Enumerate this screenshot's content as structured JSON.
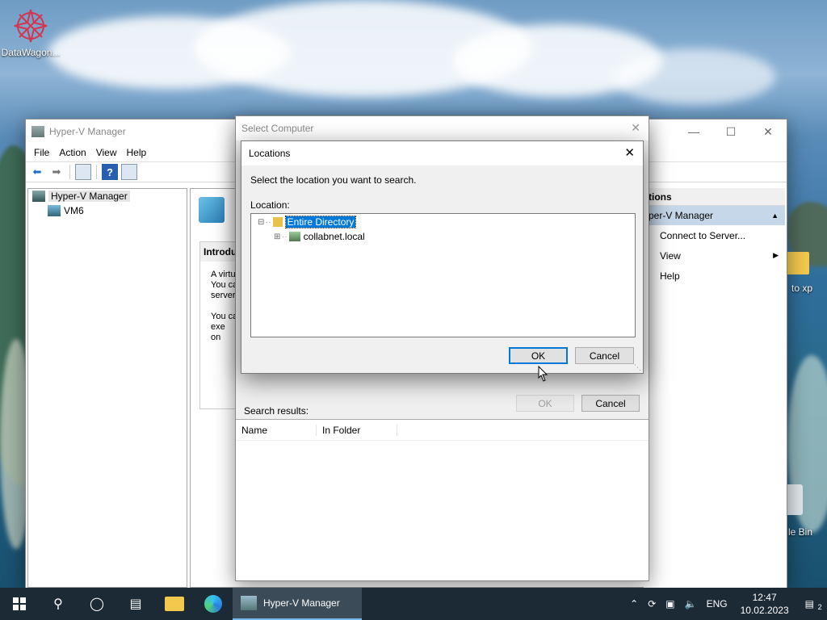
{
  "desktop": {
    "icons": [
      {
        "label": "DataWagon...",
        "icon": "datawagon-app-icon"
      },
      {
        "label": "to xp",
        "icon": "folder-icon"
      },
      {
        "label": "le Bin",
        "icon": "recycle-bin-icon"
      }
    ]
  },
  "hyperv": {
    "title": "Hyper-V Manager",
    "menu": [
      "File",
      "Action",
      "View",
      "Help"
    ],
    "tree": {
      "root": "Hyper-V Manager",
      "child": "VM6"
    },
    "center": {
      "intro_head": "Introdu",
      "text_lines": [
        "A virtu",
        "You ca",
        "server.",
        "",
        "You ca",
        "exe",
        "on"
      ]
    },
    "actions": {
      "header": "tions",
      "section": "per-V Manager",
      "items": [
        "Connect to Server...",
        "View",
        "Help"
      ]
    }
  },
  "select_computer": {
    "title": "Select Computer",
    "ok_label": "OK",
    "cancel_label": "Cancel",
    "search_results_label": "Search results:",
    "columns": [
      "Name",
      "In Folder"
    ]
  },
  "locations": {
    "title": "Locations",
    "instruction": "Select the location you want to search.",
    "location_label": "Location:",
    "tree": [
      {
        "label": "Entire Directory",
        "selected": true
      },
      {
        "label": "collabnet.local",
        "selected": false
      }
    ],
    "ok_label": "OK",
    "cancel_label": "Cancel"
  },
  "taskbar": {
    "app_label": "Hyper-V Manager",
    "lang": "ENG",
    "time": "12:47",
    "date": "10.02.2023",
    "notifications": "2"
  }
}
